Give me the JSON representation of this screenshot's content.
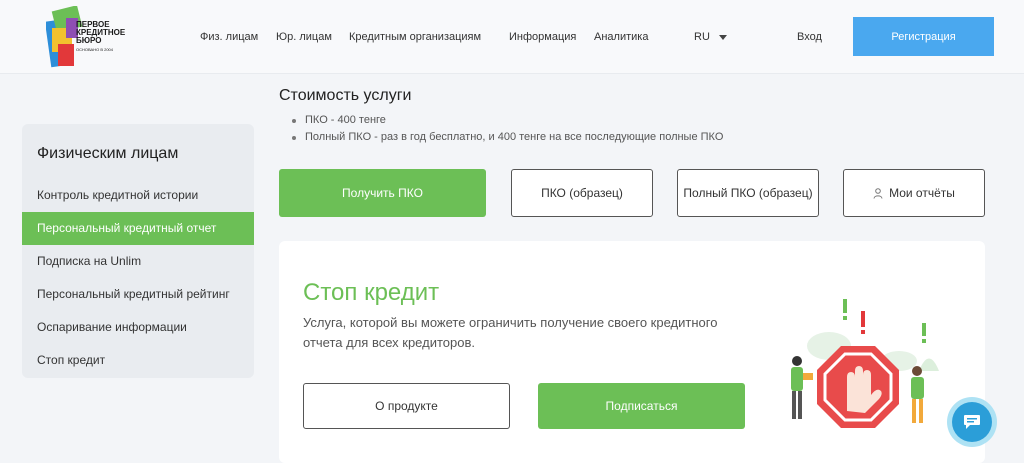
{
  "header": {
    "logo_text": [
      "ПЕРВОЕ",
      "КРЕДИТНОЕ",
      "БЮРО"
    ],
    "logo_sub": "ОСНОВАНО В 2004",
    "nav": [
      {
        "label": "Физ. лицам"
      },
      {
        "label": "Юр. лицам"
      },
      {
        "label": "Кредитным организациям"
      },
      {
        "label": "Информация"
      },
      {
        "label": "Аналитика"
      }
    ],
    "language": "RU",
    "login": "Вход",
    "register": "Регистрация"
  },
  "sidebar": {
    "title": "Физическим лицам",
    "items": [
      {
        "label": "Контроль кредитной истории",
        "active": false
      },
      {
        "label": "Персональный кредитный отчет",
        "active": true
      },
      {
        "label": "Подписка на Unlim",
        "active": false
      },
      {
        "label": "Персональный кредитный рейтинг",
        "active": false
      },
      {
        "label": "Оспаривание информации",
        "active": false
      },
      {
        "label": "Стоп кредит",
        "active": false
      }
    ]
  },
  "main": {
    "title": "Стоимость услуги",
    "bullets": [
      "ПКО - 400 тенге",
      "Полный ПКО - раз в год бесплатно, и 400 тенге на все последующие полные ПКО"
    ],
    "buttons": {
      "get_pko": "Получить ПКО",
      "pko_sample": "ПКО (образец)",
      "full_pko_sample": "Полный ПКО (образец)",
      "my_reports": "Мои отчёты"
    }
  },
  "card": {
    "title": "Стоп кредит",
    "description": "Услуга, которой вы можете ограничить получение своего кредитного отчета для всех кредиторов.",
    "about_button": "О продукте",
    "subscribe_button": "Подписаться"
  },
  "colors": {
    "accent_green": "#6cbf56",
    "accent_blue": "#4aa8ef",
    "stop_red": "#e84b4b"
  },
  "icons": {
    "chat": "chat-bubble-icon",
    "user": "user-icon",
    "caret": "chevron-down-icon"
  }
}
